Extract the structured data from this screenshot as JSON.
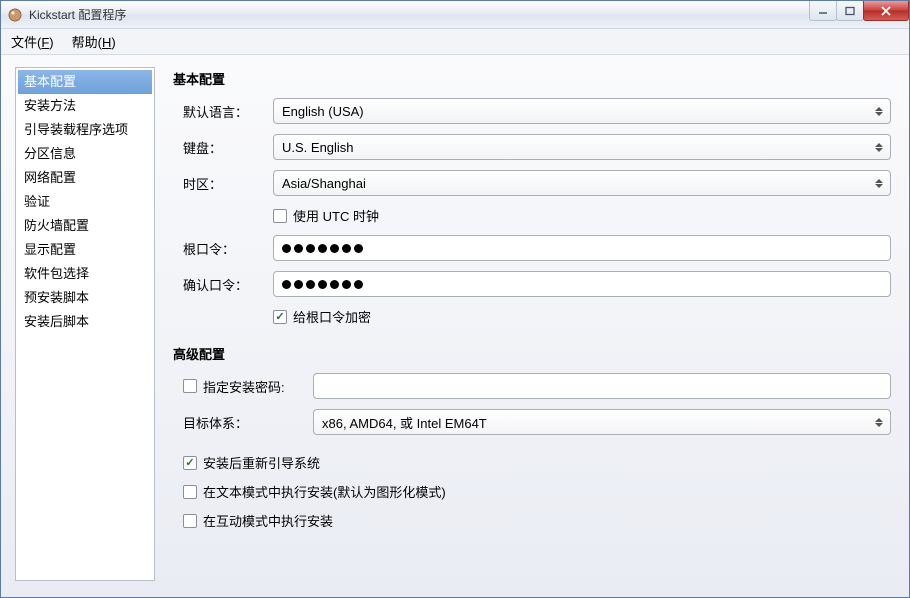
{
  "window": {
    "title": "Kickstart 配置程序"
  },
  "menubar": {
    "file_label": "文件(",
    "file_accel": "F",
    "file_tail": ")",
    "help_label": "帮助(",
    "help_accel": "H",
    "help_tail": ")"
  },
  "sidebar": {
    "items": [
      "基本配置",
      "安装方法",
      "引导装载程序选项",
      "分区信息",
      "网络配置",
      "验证",
      "防火墙配置",
      "显示配置",
      "软件包选择",
      "预安装脚本",
      "安装后脚本"
    ],
    "selected_index": 0
  },
  "main": {
    "section_basic_title": "基本配置",
    "labels": {
      "lang": "默认语言：",
      "kbd": "键盘：",
      "timezone": "时区：",
      "utc": "使用 UTC 时钟",
      "rootpw": "根口令：",
      "confirm": "确认口令：",
      "encrypt": "给根口令加密"
    },
    "values": {
      "lang": "English (USA)",
      "kbd": "U.S. English",
      "timezone": "Asia/Shanghai"
    },
    "passwords": {
      "dot_count": 7
    },
    "checks": {
      "utc": false,
      "encrypt": true
    },
    "section_adv_title": "高级配置",
    "adv": {
      "install_pwd_label": "指定安装密码:",
      "install_pwd_checked": false,
      "install_pwd_value": "",
      "target_arch_label": "目标体系：",
      "target_arch_value": "x86, AMD64, 或 Intel EM64T",
      "reboot_label": "安装后重新引导系统",
      "reboot_checked": true,
      "textmode_label": "在文本模式中执行安装(默认为图形化模式)",
      "textmode_checked": false,
      "interactive_label": "在互动模式中执行安装",
      "interactive_checked": false
    }
  }
}
